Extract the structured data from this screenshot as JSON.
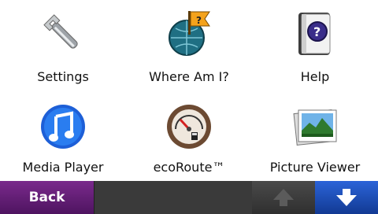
{
  "menu": {
    "items": [
      {
        "label": "Settings",
        "icon": "settings-wrench-icon"
      },
      {
        "label": "Where Am I?",
        "icon": "globe-question-flag-icon"
      },
      {
        "label": "Help",
        "icon": "help-book-icon"
      },
      {
        "label": "Media Player",
        "icon": "music-note-icon"
      },
      {
        "label": "ecoRoute™",
        "icon": "fuel-gauge-icon"
      },
      {
        "label": "Picture Viewer",
        "icon": "picture-icon"
      }
    ]
  },
  "toolbar": {
    "back_label": "Back",
    "up_icon": "arrow-up-icon",
    "down_icon": "arrow-down-icon"
  },
  "colors": {
    "back_button": "#6b1f7f",
    "down_button": "#1e4fc2",
    "toolbar_bg": "#3a3a3a"
  }
}
